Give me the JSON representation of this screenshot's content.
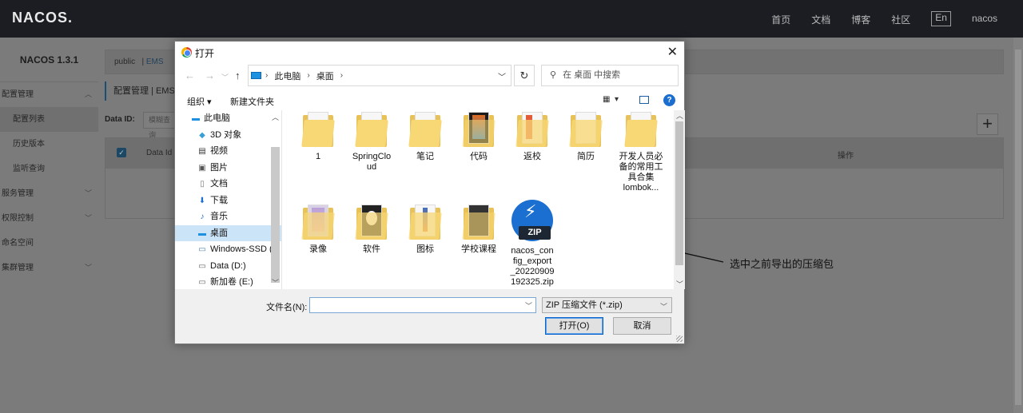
{
  "app": {
    "logo": "NACOS.",
    "top_nav": [
      "首页",
      "文档",
      "博客",
      "社区"
    ],
    "language": "En",
    "user": "nacos",
    "version": "NACOS 1.3.1",
    "sidebar": [
      {
        "label": "配置管理",
        "sub": false,
        "chevron": "︿"
      },
      {
        "label": "配置列表",
        "sub": true,
        "active": true
      },
      {
        "label": "历史版本",
        "sub": true
      },
      {
        "label": "监听查询",
        "sub": true
      },
      {
        "label": "服务管理",
        "sub": false,
        "chevron": "﹀"
      },
      {
        "label": "权限控制",
        "sub": false,
        "chevron": "﹀"
      },
      {
        "label": "命名空间",
        "sub": false
      },
      {
        "label": "集群管理",
        "sub": false,
        "chevron": "﹀"
      }
    ],
    "namespace_public": "public",
    "namespace_sep": "|",
    "namespace_ems": "EMS",
    "breadcrumb": "配置管理 | EMS",
    "data_id_label": "Data ID:",
    "data_id_placeholder": "模糊查询",
    "table_col_dataid": "Data Id",
    "table_col_ops": "操作",
    "plus": "+"
  },
  "dialog": {
    "title": "打开",
    "close": "✕",
    "path": [
      "此电脑",
      "桌面"
    ],
    "search_placeholder": "在 桌面 中搜索",
    "organize": "组织 ▾",
    "new_folder": "新建文件夹",
    "nav_tree": [
      {
        "label": "此电脑",
        "icon": "computer-icon",
        "root": true
      },
      {
        "label": "3D 对象",
        "icon": "cube-icon"
      },
      {
        "label": "视频",
        "icon": "video-icon"
      },
      {
        "label": "图片",
        "icon": "picture-icon"
      },
      {
        "label": "文档",
        "icon": "document-icon"
      },
      {
        "label": "下载",
        "icon": "download-icon"
      },
      {
        "label": "音乐",
        "icon": "music-icon"
      },
      {
        "label": "桌面",
        "icon": "desktop-icon",
        "selected": true
      },
      {
        "label": "Windows-SSD (",
        "icon": "drive-icon"
      },
      {
        "label": "Data (D:)",
        "icon": "drive-icon"
      },
      {
        "label": "新加卷 (E:)",
        "icon": "drive-icon"
      }
    ],
    "files": [
      {
        "name": "1",
        "type": "folder"
      },
      {
        "name": "SpringCloud",
        "type": "folder"
      },
      {
        "name": "笔记",
        "type": "folder"
      },
      {
        "name": "代码",
        "type": "folder"
      },
      {
        "name": "返校",
        "type": "folder"
      },
      {
        "name": "简历",
        "type": "folder"
      },
      {
        "name": "开发人员必备的常用工具合集lombok...",
        "type": "folder"
      },
      {
        "name": "录像",
        "type": "folder"
      },
      {
        "name": "软件",
        "type": "folder"
      },
      {
        "name": "图标",
        "type": "folder"
      },
      {
        "name": "学校课程",
        "type": "folder"
      },
      {
        "name": "nacos_config_export_20220909192325.zip",
        "type": "zip"
      }
    ],
    "filename_label": "文件名(N):",
    "filename_value": "",
    "filetype": "ZIP 压缩文件 (*.zip)",
    "open_button": "打开(O)",
    "cancel_button": "取消"
  },
  "annotation": "选中之前导出的压缩包"
}
